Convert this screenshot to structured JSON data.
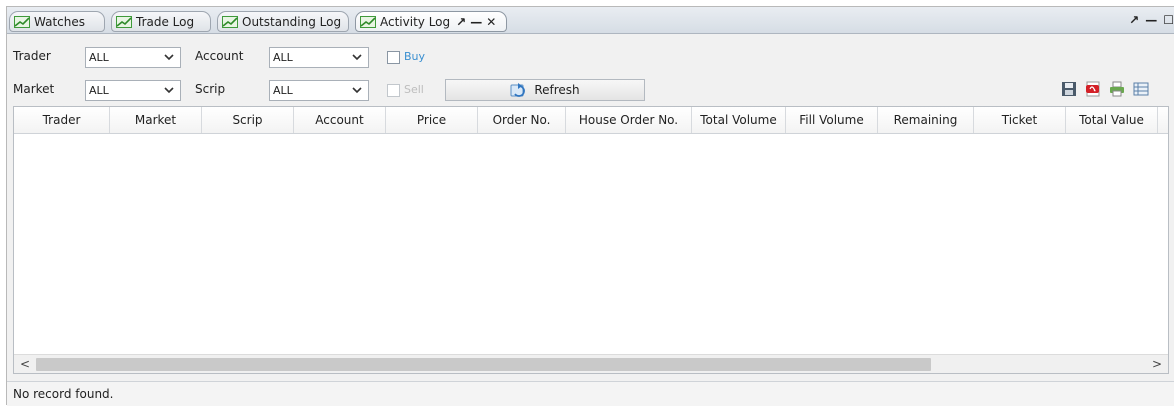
{
  "tabs": [
    {
      "label": "Watches"
    },
    {
      "label": "Trade Log"
    },
    {
      "label": "Outstanding Log"
    },
    {
      "label": "Activity Log"
    }
  ],
  "active_tab_controls": {
    "pin": "↗",
    "minimize": "—",
    "close": "✕"
  },
  "window_controls": {
    "pin": "↗",
    "minimize": "—",
    "maximize": "☐"
  },
  "filters": {
    "trader": {
      "label": "Trader",
      "value": "ALL"
    },
    "account": {
      "label": "Account",
      "value": "ALL"
    },
    "market": {
      "label": "Market",
      "value": "ALL"
    },
    "scrip": {
      "label": "Scrip",
      "value": "ALL"
    },
    "buy": {
      "label": "Buy",
      "checked": false,
      "color": "#3a8fd0"
    },
    "sell": {
      "label": "Sell",
      "checked": false,
      "color": "#bdbdbd"
    },
    "refresh_label": "Refresh"
  },
  "toolbar_icons": [
    "save-icon",
    "pdf-icon",
    "print-icon",
    "grid-view-icon"
  ],
  "table": {
    "columns": [
      "Trader",
      "Market",
      "Scrip",
      "Account",
      "Price",
      "Order No.",
      "House Order No.",
      "Total Volume",
      "Fill Volume",
      "Remaining",
      "Ticket",
      "Total Value"
    ],
    "rows": []
  },
  "scrollbar": {
    "left": "<",
    "right": ">"
  },
  "status": {
    "message": "No record found."
  }
}
